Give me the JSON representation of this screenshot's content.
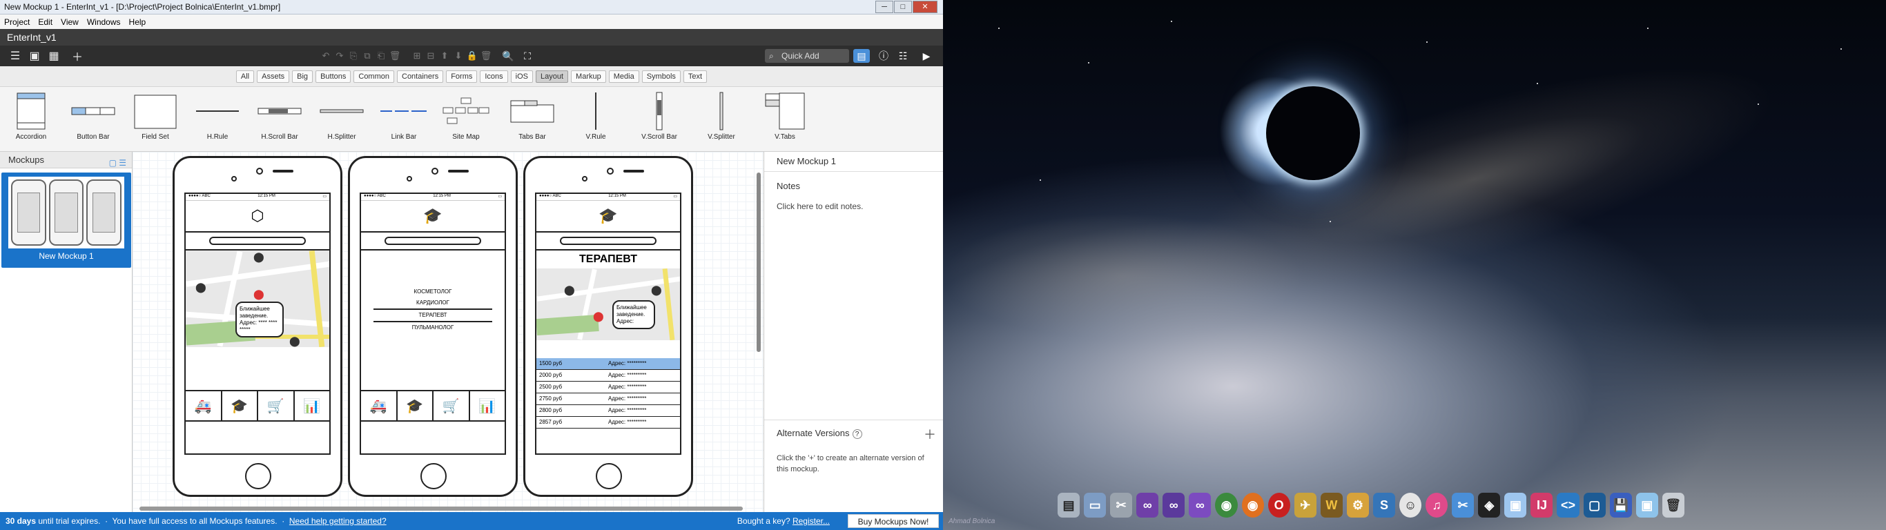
{
  "window": {
    "title": "New Mockup 1 - EnterInt_v1 - [D:\\Project\\Project Bolnica\\EnterInt_v1.bmpr]",
    "min": "─",
    "max": "□",
    "close": "✕"
  },
  "menu": [
    "Project",
    "Edit",
    "View",
    "Windows",
    "Help"
  ],
  "document": {
    "title": "EnterInt_v1"
  },
  "toolbar": {
    "quick_add_placeholder": "Quick Add"
  },
  "library": {
    "tabs": [
      "All",
      "Assets",
      "Big",
      "Buttons",
      "Common",
      "Containers",
      "Forms",
      "Icons",
      "iOS",
      "Layout",
      "Markup",
      "Media",
      "Symbols",
      "Text"
    ],
    "active_tab": "Layout",
    "items": [
      "Accordion",
      "Button Bar",
      "Field Set",
      "H.Rule",
      "H.Scroll Bar",
      "H.Splitter",
      "Link Bar",
      "Site Map",
      "Tabs Bar",
      "V.Rule",
      "V.Scroll Bar",
      "V.Splitter",
      "V.Tabs"
    ]
  },
  "mockups_panel": {
    "title": "Mockups",
    "items": [
      {
        "name": "New Mockup 1"
      }
    ]
  },
  "canvas": {
    "phone1": {
      "status_left": "●●●●○ ABC",
      "status_center": "12:15 PM",
      "bubble_text": "Ближайшее заведение. Адрес: **** **** *****"
    },
    "phone2": {
      "status_left": "●●●●○ ABC",
      "status_center": "12:15 PM",
      "menu_items": [
        "КОСМЕТОЛОГ",
        "КАРДИОЛОГ",
        "ТЕРАПЕВТ",
        "ПУЛЬМАНОЛОГ"
      ],
      "selected_item": "ТЕРАПЕВТ"
    },
    "phone3": {
      "status_left": "●●●●○ ABC",
      "status_center": "12:15 PM",
      "title": "ТЕРАПЕВТ",
      "bubble_text": "Ближайшее заведение. Адрес:",
      "prices": [
        {
          "price": "1500 руб",
          "addr": "Адрес: *********"
        },
        {
          "price": "2000 руб",
          "addr": "Адрес: *********"
        },
        {
          "price": "2500 руб",
          "addr": "Адрес: *********"
        },
        {
          "price": "2750 руб",
          "addr": "Адрес: *********"
        },
        {
          "price": "2800 руб",
          "addr": "Адрес: *********"
        },
        {
          "price": "2857 руб",
          "addr": "Адрес: *********"
        }
      ]
    }
  },
  "right_panel": {
    "mockup_title": "New Mockup 1",
    "notes_label": "Notes",
    "notes_hint": "Click here to edit notes.",
    "alt_title": "Alternate Versions",
    "alt_hint": "Click the '+' to create an alternate version of this mockup."
  },
  "statusbar": {
    "trial_bold": "30 days",
    "trial_text": " until trial expires.  ·  You have full access to all Mockups features.  ·  ",
    "help_link": "Need help getting started?",
    "bought_text": "Bought a key? ",
    "register_link": "Register...",
    "buy_button": "Buy Mockups Now!"
  },
  "desktop": {
    "signature": "Ahmad Bolnica",
    "dock_icons": [
      "file-manager-icon",
      "folder-icon",
      "tools-icon",
      "visual-studio-icon",
      "visual-studio-2-icon",
      "visual-studio-3-icon",
      "chrome-icon",
      "firefox-icon",
      "opera-icon",
      "plane-icon",
      "warcraft-icon",
      "settings-icon",
      "sourcetree-icon",
      "smiley-icon",
      "itunes-icon",
      "scissors-icon",
      "unity-icon",
      "box-icon",
      "intellij-icon",
      "code-icon",
      "frame-icon",
      "save-icon",
      "cube-icon",
      "trash-icon"
    ]
  },
  "colors": {
    "accent": "#1a73c9",
    "toolbar": "#2e2e2e",
    "highlight_row": "#8cb8e8"
  }
}
